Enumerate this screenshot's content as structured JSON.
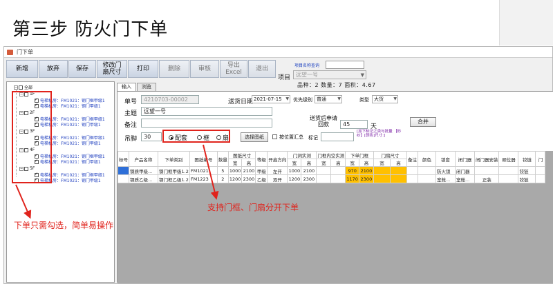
{
  "slide": {
    "title": "第三步 防火门下单",
    "callout_tree": "下单只需勾选，简单易操作",
    "callout_radio": "支持门框、门扇分开下单"
  },
  "window": {
    "title": "门下单"
  },
  "toolbar": {
    "buttons": [
      "新增",
      "放弃",
      "保存",
      "修改门扇尺寸",
      "打印",
      "删除",
      "审核",
      "导出Excel",
      "退出"
    ]
  },
  "project": {
    "search_label": "项目名称查询",
    "label": "项目",
    "selected": "远望一号",
    "summary": "品种：2 数量：7 面积：4.67"
  },
  "tree": {
    "root": "全部",
    "groups": [
      "1F",
      "2F",
      "3F",
      "4F",
      "5F"
    ],
    "items": [
      "电梯机房：FM1021：钢门框甲级1",
      "电梯机房：FM1021：钢门甲级1",
      "电梯机房：FM1021：钢门框甲级1",
      "电梯机房：FM1021：钢门甲级1",
      "电梯机房：FM1021：钢门框甲级1",
      "电梯机房：FM1021：钢门甲级1",
      "电梯机房：FM1021：钢门框甲级1",
      "电梯机房：FM1021：钢门甲级1",
      "电梯机房：FM1021：钢门框甲级1",
      "电梯机房：FM1021：钢门甲级1"
    ]
  },
  "tabs": [
    "输入",
    "浏览"
  ],
  "form": {
    "order_no_label": "单号",
    "order_no": "4210703-00002",
    "delivery_date_label": "送货日期",
    "delivery_date": "2021-07-15",
    "priority_label": "优先级别",
    "priority": "普通",
    "type_label": "类型",
    "type": "大货",
    "subject_label": "主题",
    "subject": "远望一号",
    "remark_label": "备注",
    "return_days_label": "送货后申请回款",
    "return_days": "45",
    "days_unit": "天",
    "merge_button": "合并",
    "foot_label": "吊脚",
    "foot_value": "30",
    "radio_options": [
      "配套",
      "框",
      "扇"
    ],
    "radio_selected": "配套",
    "select_drawing_button": "选择图纸",
    "by_position_label": "按位置汇总",
    "mark_label": "标记",
    "note": "[加下标记之类与批量 【砂纱】[颜色]尺寸:]"
  },
  "grid": {
    "header_top": [
      "标号",
      "产品名称",
      "下单类别",
      "图纸编号",
      "数量",
      "图纸尺寸",
      "等级",
      "开启方向",
      "门洞实测",
      "门框内空实测",
      "下单门框",
      "门扇尺寸",
      "备注",
      "颜色",
      "锁套",
      "闭门器",
      "闭门器安装",
      "顺位器",
      "铰链",
      "门"
    ],
    "header_sub": [
      "宽",
      "高",
      "宽",
      "高",
      "宽",
      "高",
      "宽",
      "高",
      "宽",
      "高"
    ],
    "rows": [
      {
        "product": "钢质甲级...",
        "category": "钢门框甲级1.2",
        "drawing": "FM1021",
        "qty": "5",
        "draw_w": "1000",
        "draw_h": "2100",
        "grade": "甲级",
        "open": "左开",
        "hole_w": "1000",
        "hole_h": "2100",
        "frame_w": "970",
        "frame_h": "2100",
        "color": "",
        "lock": "防火锁",
        "closer": "闭门器",
        "closer_install": "",
        "hinge": "铰链"
      },
      {
        "product": "钢质乙级...",
        "category": "钢门框乙级1.2",
        "drawing": "FM1223",
        "qty": "2",
        "draw_w": "1200",
        "draw_h": "2300",
        "grade": "乙级",
        "open": "双开",
        "hole_w": "1200",
        "hole_h": "2300",
        "frame_w": "1170",
        "frame_h": "2300",
        "color": "",
        "lock": "室舱...",
        "closer": "室舱...",
        "closer_install": "正装",
        "hinge": "铰链"
      }
    ]
  },
  "colors": {
    "callout": "#e0231c",
    "highlight": "#ffc000",
    "tree_text": "#1f3fbf"
  }
}
